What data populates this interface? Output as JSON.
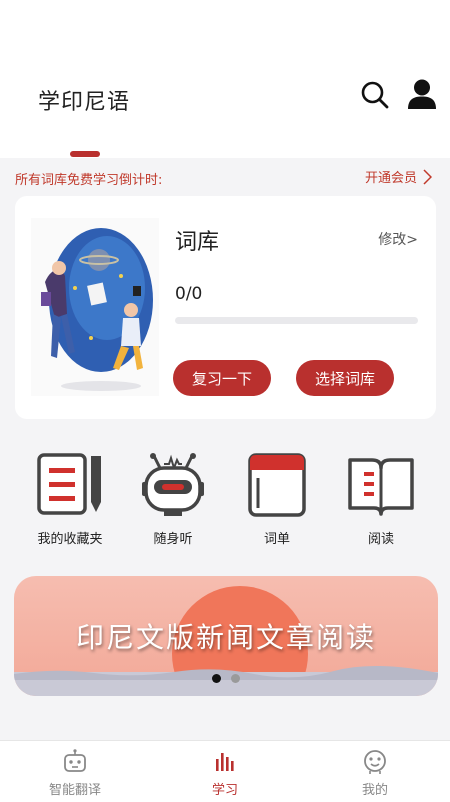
{
  "header": {
    "title": "学印尼语",
    "search_icon": "search-icon",
    "user_icon": "user-icon"
  },
  "notice": {
    "text": "所有词库免费学习倒计时:",
    "vip_label": "开通会员"
  },
  "card": {
    "title": "词库",
    "edit_label": "修改>",
    "progress_text": "0/0",
    "progress_fraction": 0,
    "review_button": "复习一下",
    "select_button": "选择词库"
  },
  "features": [
    {
      "label": "我的收藏夹",
      "icon": "favorites-list-icon"
    },
    {
      "label": "随身听",
      "icon": "robot-radio-icon"
    },
    {
      "label": "词单",
      "icon": "wordbook-icon"
    },
    {
      "label": "阅读",
      "icon": "open-book-icon"
    }
  ],
  "banner": {
    "text": "印尼文版新闻文章阅读",
    "active_slide": 1,
    "slide_count": 2
  },
  "bottom_nav": [
    {
      "label": "智能翻译",
      "icon": "robot-icon",
      "active": false
    },
    {
      "label": "学习",
      "icon": "bar-chart-icon",
      "active": true
    },
    {
      "label": "我的",
      "icon": "face-icon",
      "active": false
    }
  ],
  "colors": {
    "accent": "#b9302e",
    "background": "#f4f4f6",
    "card": "#ffffff"
  }
}
